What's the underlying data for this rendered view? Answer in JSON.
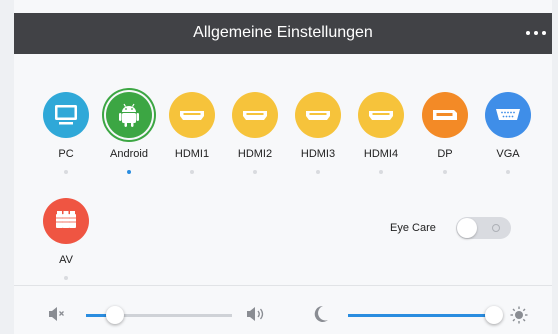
{
  "header": {
    "title": "Allgemeine Einstellungen"
  },
  "sources": [
    {
      "label": "PC",
      "icon": "monitor-icon",
      "color": "#2fa8d8",
      "selected": false
    },
    {
      "label": "Android",
      "icon": "android-icon",
      "color": "#3ca643",
      "selected": true
    },
    {
      "label": "HDMI1",
      "icon": "hdmi-icon",
      "color": "#f6c33b",
      "selected": false
    },
    {
      "label": "HDMI2",
      "icon": "hdmi-icon",
      "color": "#f6c33b",
      "selected": false
    },
    {
      "label": "HDMI3",
      "icon": "hdmi-icon",
      "color": "#f6c33b",
      "selected": false
    },
    {
      "label": "HDMI4",
      "icon": "hdmi-icon",
      "color": "#f6c33b",
      "selected": false
    },
    {
      "label": "DP",
      "icon": "displayport-icon",
      "color": "#f38a26",
      "selected": false
    },
    {
      "label": "VGA",
      "icon": "vga-icon",
      "color": "#3f8ee8",
      "selected": false
    },
    {
      "label": "AV",
      "icon": "av-icon",
      "color": "#ef5542",
      "selected": false
    }
  ],
  "eye_care": {
    "label": "Eye Care",
    "enabled": false
  },
  "volume": {
    "level": 0.2,
    "accent": "#2a8de0"
  },
  "brightness": {
    "level": 0.97,
    "accent": "#2a8de0"
  }
}
